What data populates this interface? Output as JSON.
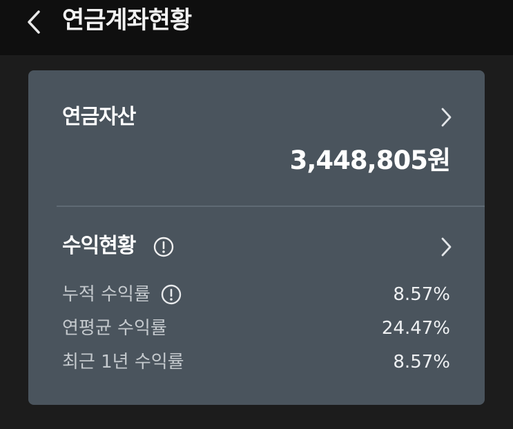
{
  "header": {
    "title": "연금계좌현황"
  },
  "pension_assets": {
    "title": "연금자산",
    "amount": "3,448,805원"
  },
  "returns": {
    "title": "수익현황",
    "rows": [
      {
        "label": "누적 수익률",
        "value": "8.57%"
      },
      {
        "label": "연평균 수익률",
        "value": "24.47%"
      },
      {
        "label": "최근 1년 수익률",
        "value": "8.57%"
      }
    ]
  },
  "colors": {
    "background": "#1c1c1c",
    "topbar": "#0f0f0f",
    "card": "#4a545d",
    "text_primary": "#ffffff",
    "text_secondary": "#c4c9cd"
  },
  "icons": {
    "back": "chevron-left-icon",
    "navigate": "chevron-right-icon",
    "info": "info-circle-icon"
  }
}
